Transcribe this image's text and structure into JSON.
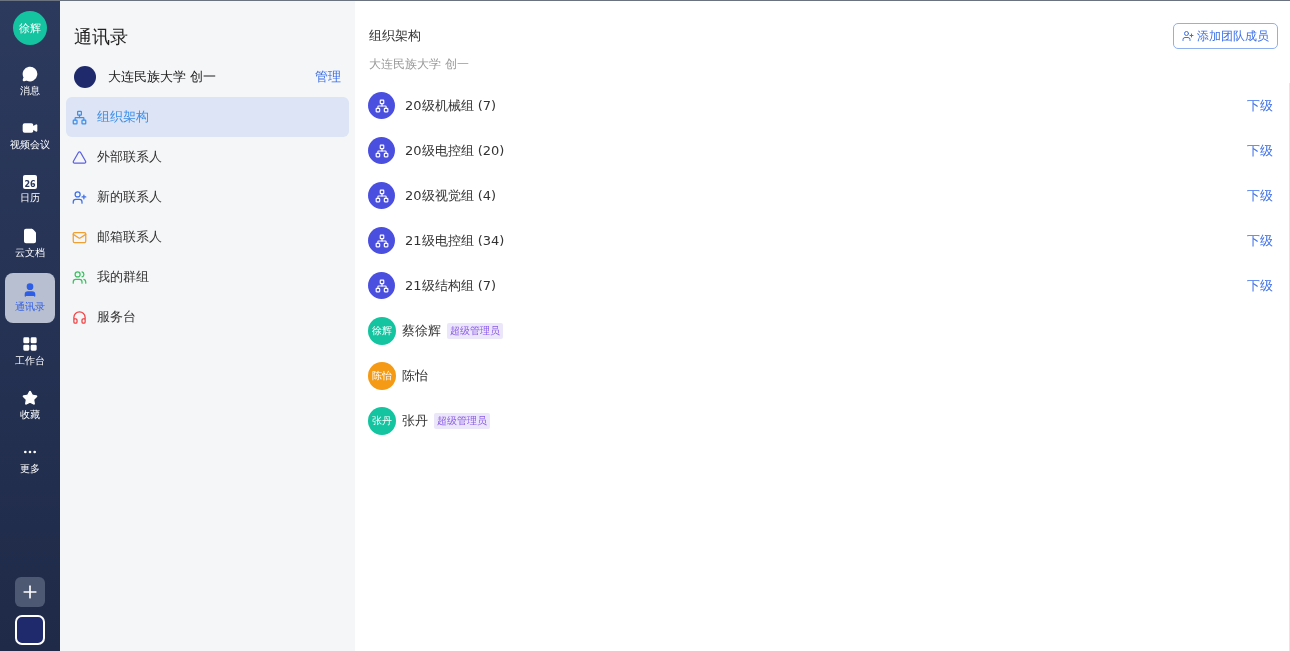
{
  "rail": {
    "avatar": "徐辉",
    "items": [
      {
        "label": "消息",
        "selected": false
      },
      {
        "label": "视频会议",
        "selected": false
      },
      {
        "label": "日历",
        "selected": false,
        "day": "26"
      },
      {
        "label": "云文档",
        "selected": false
      },
      {
        "label": "通讯录",
        "selected": true
      },
      {
        "label": "工作台",
        "selected": false
      },
      {
        "label": "收藏",
        "selected": false
      },
      {
        "label": "更多",
        "selected": false
      }
    ]
  },
  "sidebar": {
    "title": "通讯录",
    "org": {
      "name": "大连民族大学 创一",
      "action": "管理"
    },
    "items": [
      {
        "label": "组织架构",
        "selected": true
      },
      {
        "label": "外部联系人",
        "selected": false
      },
      {
        "label": "新的联系人",
        "selected": false
      },
      {
        "label": "邮箱联系人",
        "selected": false
      },
      {
        "label": "我的群组",
        "selected": false
      },
      {
        "label": "服务台",
        "selected": false
      }
    ]
  },
  "main": {
    "title": "组织架构",
    "add_button": "添加团队成员",
    "breadcrumb": "大连民族大学 创一",
    "rows": [
      {
        "kind": "group",
        "name": "20级机械组 (7)",
        "action": "下级"
      },
      {
        "kind": "group",
        "name": "20级电控组 (20)",
        "action": "下级"
      },
      {
        "kind": "group",
        "name": "20级视觉组 (4)",
        "action": "下级"
      },
      {
        "kind": "group",
        "name": "21级电控组 (34)",
        "action": "下级"
      },
      {
        "kind": "group",
        "name": "21级结构组 (7)",
        "action": "下级"
      },
      {
        "kind": "member",
        "avatar": "徐辉",
        "color": "#14c4a0",
        "name": "蔡徐辉",
        "badge": "超级管理员"
      },
      {
        "kind": "member",
        "avatar": "陈怡",
        "color": "#f59a14",
        "name": "陈怡"
      },
      {
        "kind": "member",
        "avatar": "张丹",
        "color": "#14c4a0",
        "name": "张丹",
        "badge": "超级管理员"
      }
    ]
  }
}
